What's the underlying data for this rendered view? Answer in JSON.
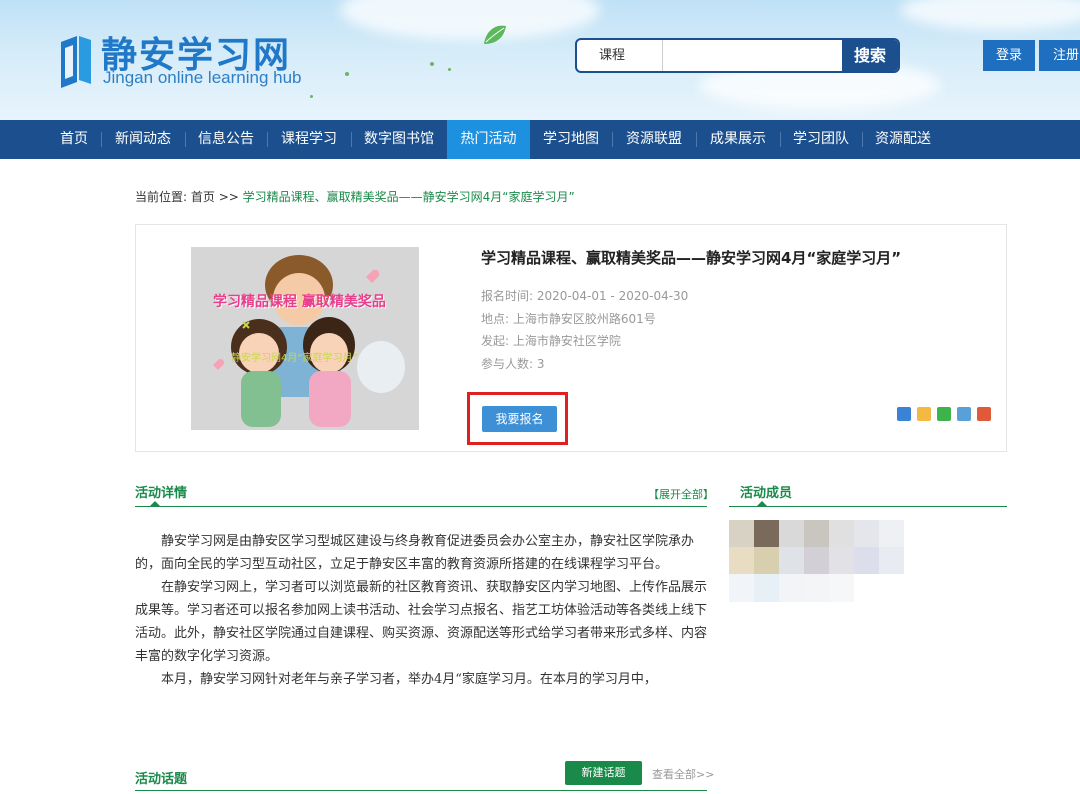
{
  "header": {
    "logo_title": "静安学习网",
    "logo_subtitle": "Jingan online learning hub",
    "search": {
      "category": "课程",
      "value": "",
      "button": "搜索"
    },
    "login": "登录",
    "register": "注册"
  },
  "nav": {
    "items": [
      "首页",
      "新闻动态",
      "信息公告",
      "课程学习",
      "数字图书馆",
      "热门活动",
      "学习地图",
      "资源联盟",
      "成果展示",
      "学习团队",
      "资源配送"
    ],
    "active": "热门活动"
  },
  "breadcrumb": {
    "prefix": "当前位置:",
    "home": "首页",
    "sep": ">>",
    "current": "学习精品课程、赢取精美奖品——静安学习网4月“家庭学习月”"
  },
  "activity": {
    "title": "学习精品课程、赢取精美奖品——静安学习网4月“家庭学习月”",
    "poster_text_top": "学习精品课程 赢取精美奖品",
    "poster_text_bottom": "静安学习网4月“家庭学习月”",
    "signup_time_label": "报名时间:",
    "signup_time": "2020-04-01 - 2020-04-30",
    "location_label": "地点:",
    "location": "上海市静安区胶州路601号",
    "organizer_label": "发起:",
    "organizer": "上海市静安社区学院",
    "participants_label": "参与人数:",
    "participants": "3",
    "signup_button": "我要报名"
  },
  "details": {
    "title": "活动详情",
    "expand": "【展开全部】",
    "paragraphs": [
      "静安学习网是由静安区学习型城区建设与终身教育促进委员会办公室主办，静安社区学院承办的，面向全民的学习型互动社区，立足于静安区丰富的教育资源所搭建的在线课程学习平台。",
      "在静安学习网上，学习者可以浏览最新的社区教育资讯、获取静安区内学习地图、上传作品展示成果等。学习者还可以报名参加网上读书活动、社会学习点报名、指艺工坊体验活动等各类线上线下活动。此外，静安社区学院通过自建课程、购买资源、资源配送等形式给学习者带来形式多样、内容丰富的数字化学习资源。",
      "本月，静安学习网针对老年与亲子学习者，举办4月“家庭学习月。在本月的学习月中，"
    ]
  },
  "members": {
    "title": "活动成员"
  },
  "topics": {
    "title": "活动话题",
    "new_topic": "新建话题",
    "view_all": "查看全部>>"
  },
  "colors": {
    "nav_bg": "#1b4f8e",
    "nav_active": "#1e90e0",
    "green": "#1a8a4a",
    "button_blue": "#3d8fd6",
    "highlight_red": "#e02020"
  }
}
